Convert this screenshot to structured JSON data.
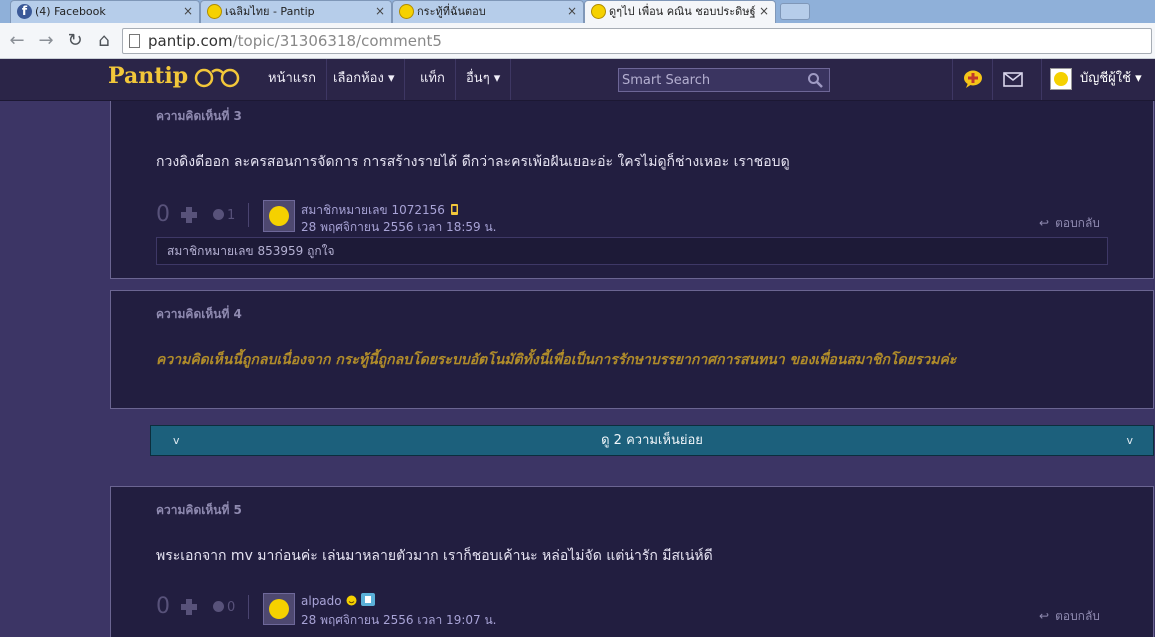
{
  "browser": {
    "tabs": [
      {
        "title": "(4) Facebook",
        "icon": "facebook-icon",
        "close": "×"
      },
      {
        "title": "เฉลิมไทย - Pantip",
        "icon": "pantip-smiley-icon",
        "close": "×"
      },
      {
        "title": "กระทู้ที่ฉันตอบ",
        "icon": "pantip-smiley-icon",
        "close": "×"
      },
      {
        "title": "ดูๆไป เพื่อน คณิน ชอบประดิษฐ์",
        "icon": "pantip-smiley-icon",
        "close": "×"
      }
    ],
    "nav": {
      "back": "←",
      "forward": "→",
      "reload": "↻",
      "home": "⌂"
    },
    "url_domain": "pantip.com",
    "url_path": "/topic/31306318/comment5"
  },
  "site": {
    "logo": "Pantip",
    "menu": {
      "home": "หน้าแรก",
      "rooms": "เลือกห้อง ▾",
      "tags": "แท็ก",
      "more": "อื่นๆ ▾"
    },
    "search_placeholder": "Smart Search",
    "account": "บัญชีผู้ใช้ ▾"
  },
  "comments": {
    "c3": {
      "number": "ความคิดเห็นที่ 3",
      "body": "กวงดิงดีออก ละครสอนการจัดการ การสร้างรายได้ ดีกว่าละครเพ้อฝันเยอะอ่ะ ใครไม่ดูก็ช่างเหอะ เราชอบดู",
      "votes": "0",
      "emotions": "1",
      "user": "สมาชิกหมายเลข 1072156",
      "date": "28 พฤศจิกายน 2556 เวลา 18:59 น.",
      "reply": "ตอบกลับ",
      "likes": "สมาชิกหมายเลข 853959 ถูกใจ"
    },
    "c4": {
      "number": "ความคิดเห็นที่ 4",
      "deleted_text": "ความคิดเห็นนี้ถูกลบเนื่องจาก กระทู้นี้ถูกลบโดยระบบอัตโนมัติทั้งนี้เพื่อเป็นการรักษาบรรยากาศการสนทนา ของเพื่อนสมาชิกโดยรวมค่ะ"
    },
    "subcomments": {
      "label": "ดู 2 ความเห็นย่อย",
      "chevron": "v"
    },
    "c5": {
      "number": "ความคิดเห็นที่ 5",
      "body": "พระเอกจาก mv มาก่อนค่ะ เล่นมาหลายตัวมาก เราก็ชอบเค้านะ หล่อไม่จัด แต่น่ารัก มีสเน่ห์ดี",
      "votes": "0",
      "emotions": "0",
      "user": "alpado",
      "date": "28 พฤศจิกายน 2556 เวลา 19:07 น.",
      "reply": "ตอบกลับ"
    }
  },
  "colors": {
    "brand": "#f2c73a",
    "page_bg": "#3c3565",
    "card_bg": "#221e40",
    "subbar": "#1c607c",
    "deleted_text": "#b08c2a"
  }
}
